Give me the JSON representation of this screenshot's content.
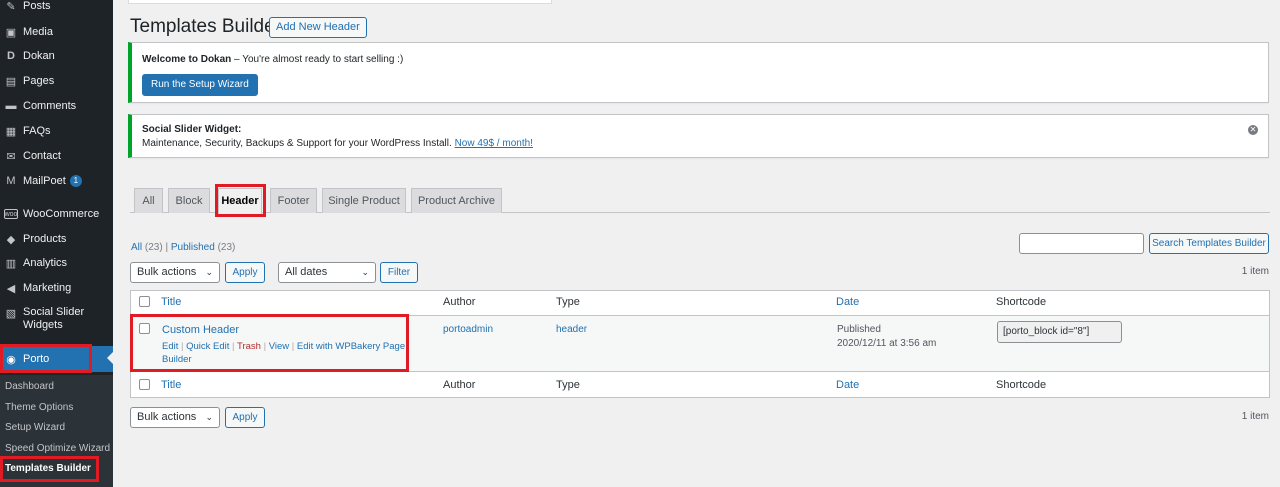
{
  "sidebar": {
    "items": [
      {
        "label": "Posts",
        "icon": "pin-icon"
      },
      {
        "label": "Media",
        "icon": "media-icon"
      },
      {
        "label": "Dokan",
        "icon": "dokan-icon"
      },
      {
        "label": "Pages",
        "icon": "pages-icon"
      },
      {
        "label": "Comments",
        "icon": "comments-icon"
      },
      {
        "label": "FAQs",
        "icon": "faqs-icon"
      },
      {
        "label": "Contact",
        "icon": "mail-icon"
      },
      {
        "label": "MailPoet",
        "icon": "mailpoet-icon",
        "badge": "1"
      },
      {
        "label": "WooCommerce",
        "icon": "woo-icon"
      },
      {
        "label": "Products",
        "icon": "products-icon"
      },
      {
        "label": "Analytics",
        "icon": "analytics-icon"
      },
      {
        "label": "Marketing",
        "icon": "megaphone-icon"
      },
      {
        "label": "Social Slider Widgets",
        "icon": "slider-icon"
      },
      {
        "label": "Porto",
        "icon": "porto-icon"
      }
    ],
    "submenu": [
      "Dashboard",
      "Theme Options",
      "Setup Wizard",
      "Speed Optimize Wizard",
      "Templates Builder"
    ]
  },
  "header": {
    "title": "Templates Builder",
    "add_new": "Add New Header"
  },
  "notices": {
    "dokan_title": "Welcome to Dokan",
    "dokan_text": " – You're almost ready to start selling :)",
    "setup_button": "Run the Setup Wizard",
    "slider_title": "Social Slider Widget:",
    "slider_text": "Maintenance, Security, Backups & Support for your WordPress Install. ",
    "slider_link": "Now 49$ / month!"
  },
  "tabs": [
    "All",
    "Block",
    "Header",
    "Footer",
    "Single Product",
    "Product Archive"
  ],
  "active_tab": "Header",
  "filters": {
    "all": "All",
    "all_count": "(23)",
    "separator": "|",
    "published": "Published",
    "published_count": "(23)",
    "search_button": "Search Templates Builder",
    "bulk_actions": "Bulk actions",
    "apply": "Apply",
    "all_dates": "All dates",
    "filter": "Filter",
    "items": "1 item"
  },
  "table": {
    "columns": [
      "Title",
      "Author",
      "Type",
      "Date",
      "Shortcode"
    ],
    "row": {
      "title": "Custom Header",
      "actions": {
        "edit": "Edit",
        "quick_edit": "Quick Edit",
        "trash": "Trash",
        "view": "View",
        "wpbakery": "Edit with WPBakery Page Builder",
        "sep": " | "
      },
      "author": "portoadmin",
      "type": "header",
      "date_status": "Published",
      "date": "2020/12/11 at 3:56 am",
      "shortcode": "[porto_block id=\"8\"]"
    }
  },
  "colors": {
    "accent": "#2271b1",
    "sidebar": "#1d2327",
    "highlight": "#e01b24",
    "notice": "#00a32a"
  }
}
